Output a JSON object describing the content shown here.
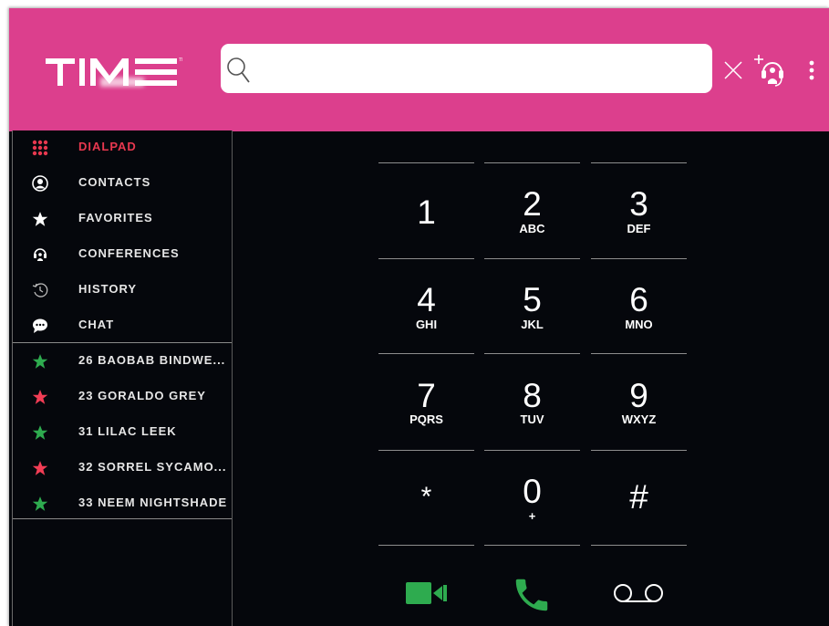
{
  "app": {
    "logo_text": "TIME"
  },
  "search": {
    "placeholder": "",
    "value": ""
  },
  "sidebar": {
    "nav": [
      {
        "label": "DIALPAD",
        "icon": "dialpad-grid-icon",
        "active": true
      },
      {
        "label": "CONTACTS",
        "icon": "contact-person-icon"
      },
      {
        "label": "FAVORITES",
        "icon": "star-icon"
      },
      {
        "label": "CONFERENCES",
        "icon": "conference-headset-icon"
      },
      {
        "label": "HISTORY",
        "icon": "history-clock-icon"
      },
      {
        "label": "CHAT",
        "icon": "chat-bubble-icon"
      }
    ],
    "favorites": [
      {
        "label": "26 BAOBAB BINDWE...",
        "status_color": "#2eab4f"
      },
      {
        "label": "23 GORALDO GREY",
        "status_color": "#f23d55"
      },
      {
        "label": "31 LILAC LEEK",
        "status_color": "#2eab4f"
      },
      {
        "label": "32 SORREL SYCAMO...",
        "status_color": "#f23d55"
      },
      {
        "label": "33 NEEM NIGHTSHADE",
        "status_color": "#2eab4f"
      }
    ]
  },
  "dialpad": {
    "keys": [
      {
        "digit": "1",
        "letters": ""
      },
      {
        "digit": "2",
        "letters": "ABC"
      },
      {
        "digit": "3",
        "letters": "DEF"
      },
      {
        "digit": "4",
        "letters": "GHI"
      },
      {
        "digit": "5",
        "letters": "JKL"
      },
      {
        "digit": "6",
        "letters": "MNO"
      },
      {
        "digit": "7",
        "letters": "PQRS"
      },
      {
        "digit": "8",
        "letters": "TUV"
      },
      {
        "digit": "9",
        "letters": "WXYZ"
      },
      {
        "digit": "*",
        "letters": ""
      },
      {
        "digit": "0",
        "letters": "+"
      },
      {
        "digit": "#",
        "letters": ""
      }
    ]
  },
  "colors": {
    "header": "#dc3f8d",
    "background": "#05070c",
    "active": "#e8384f",
    "green": "#2eab4f",
    "red": "#f23d55"
  }
}
